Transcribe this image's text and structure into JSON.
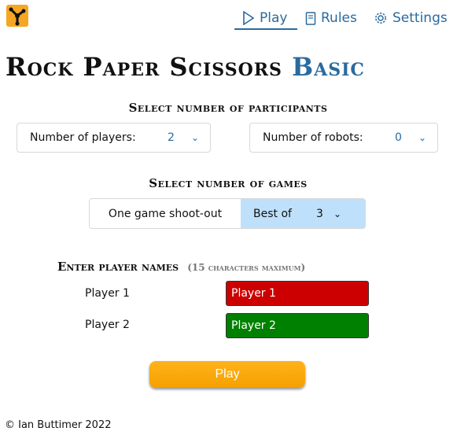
{
  "nav": {
    "play": "Play",
    "rules": "Rules",
    "settings": "Settings"
  },
  "title": {
    "main": "Rock Paper Scissors",
    "accent": "Basic"
  },
  "participants": {
    "heading": "Select number of participants",
    "players_label": "Number of players:",
    "players_value": "2",
    "robots_label": "Number of robots:",
    "robots_value": "0"
  },
  "games": {
    "heading": "Select number of games",
    "shootout_label": "One game shoot-out",
    "bestof_label": "Best of",
    "bestof_value": "3"
  },
  "names": {
    "heading": "Enter player names",
    "note": "(15 characters maximum)",
    "players": [
      {
        "label": "Player 1",
        "value": "Player 1",
        "color": "#cc0000"
      },
      {
        "label": "Player 2",
        "value": "Player 2",
        "color": "#008000"
      }
    ]
  },
  "play_button": "Play",
  "footer": "© Ian Buttimer 2022",
  "colors": {
    "accent_blue": "#2a6a9e",
    "logo_orange": "#f5a623",
    "play_orange": "#f5a000",
    "selected_option_bg": "#bfe0fb"
  },
  "icons": {
    "logo": "scissors-logo-icon",
    "play": "play-triangle-icon",
    "rules": "book-icon",
    "settings": "gear-icon",
    "dropdown": "chevron-down-icon"
  }
}
